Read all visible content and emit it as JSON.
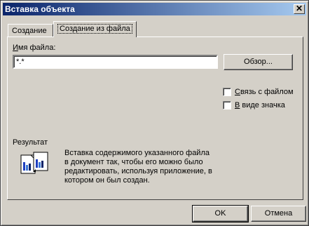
{
  "window": {
    "title": "Вставка объекта",
    "close_glyph": "✕"
  },
  "tabs": [
    {
      "label": "Создание"
    },
    {
      "label": "Создание из файла",
      "selected": true
    }
  ],
  "form": {
    "filename_label": "Имя файла:",
    "filename_value": "*.*",
    "browse_button": "Обзор..."
  },
  "options": {
    "link_label": "Связь с файлом",
    "link_checked": false,
    "icon_label": "В виде значка",
    "icon_checked": false
  },
  "result": {
    "heading": "Результат",
    "description": "Вставка содержимого указанного файла в документ так, чтобы его можно было редактировать, используя приложение, в котором он был создан.",
    "icon": "insert-object-document-icon"
  },
  "buttons": {
    "ok": "OK",
    "cancel": "Отмена"
  },
  "colors": {
    "title_start": "#0a246a",
    "title_end": "#a6caf0",
    "face": "#d4d0c8"
  }
}
